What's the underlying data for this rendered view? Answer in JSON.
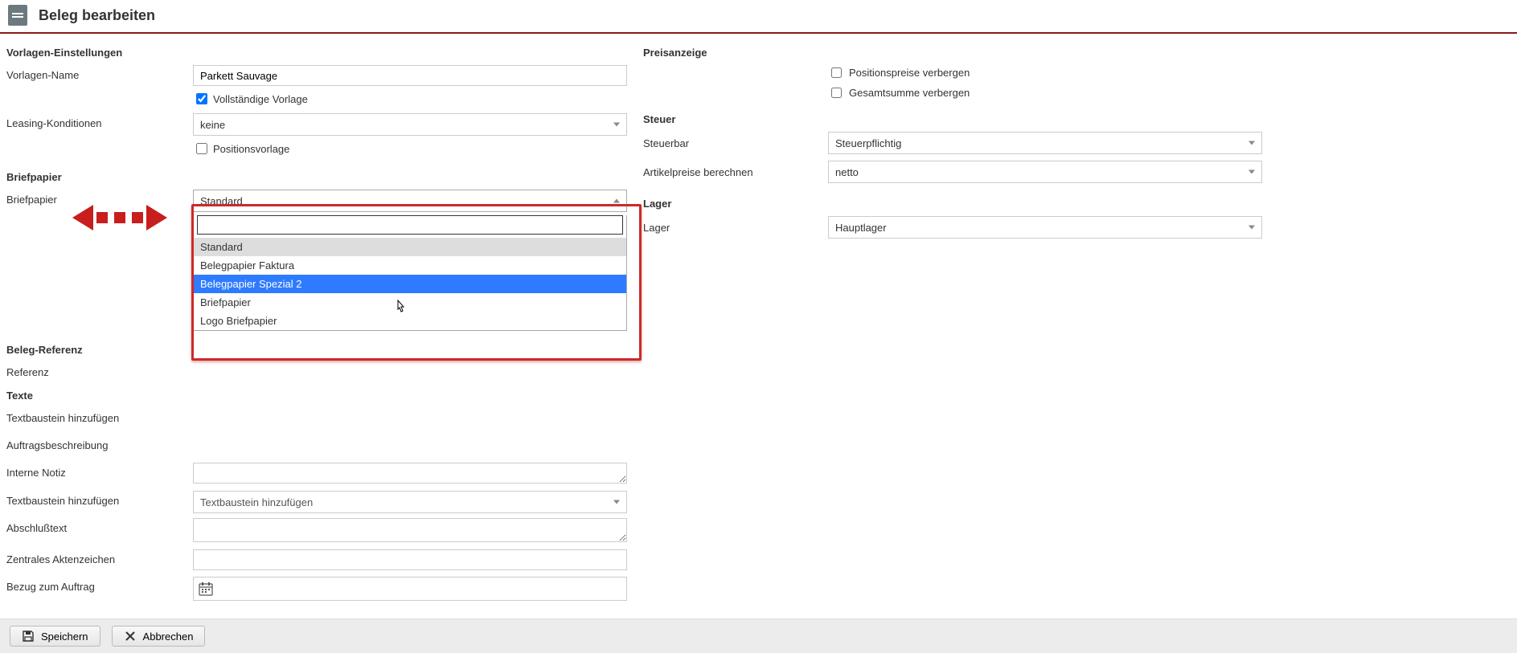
{
  "header": {
    "title": "Beleg bearbeiten"
  },
  "left": {
    "vorlagen_einstellungen_title": "Vorlagen-Einstellungen",
    "vorlagen_name_label": "Vorlagen-Name",
    "vorlagen_name_value": "Parkett Sauvage",
    "vollstaendige_vorlage_label": "Vollständige Vorlage",
    "leasing_label": "Leasing-Konditionen",
    "leasing_value": "keine",
    "positionsvorlage_label": "Positionsvorlage",
    "briefpapier_title": "Briefpapier",
    "briefpapier_label": "Briefpapier",
    "briefpapier_value": "Standard",
    "briefpapier_options": [
      "Standard",
      "Belegpapier Faktura",
      "Belegpapier Spezial 2",
      "Briefpapier",
      "Logo Briefpapier"
    ],
    "beleg_referenz_title": "Beleg-Referenz",
    "referenz_label": "Referenz",
    "texte_title": "Texte",
    "textbaustein1_label": "Textbaustein hinzufügen",
    "textbaustein1_placeholder": "Textbaustein hinzufügen",
    "auftragsbeschreibung_label": "Auftragsbeschreibung",
    "interne_notiz_label": "Interne Notiz",
    "textbaustein2_label": "Textbaustein hinzufügen",
    "textbaustein2_placeholder": "Textbaustein hinzufügen",
    "abschlusstext_label": "Abschlußtext",
    "zentrales_aktenzeichen_label": "Zentrales Aktenzeichen",
    "bezug_zum_auftrag_label": "Bezug zum Auftrag"
  },
  "right": {
    "preisanzeige_title": "Preisanzeige",
    "positionspreise_label": "Positionspreise verbergen",
    "gesamtsumme_label": "Gesamtsumme verbergen",
    "steuer_title": "Steuer",
    "steuerbar_label": "Steuerbar",
    "steuerbar_value": "Steuerpflichtig",
    "artikelpreise_label": "Artikelpreise berechnen",
    "artikelpreise_value": "netto",
    "lager_title": "Lager",
    "lager_label": "Lager",
    "lager_value": "Hauptlager"
  },
  "footer": {
    "save_label": "Speichern",
    "cancel_label": "Abbrechen"
  }
}
